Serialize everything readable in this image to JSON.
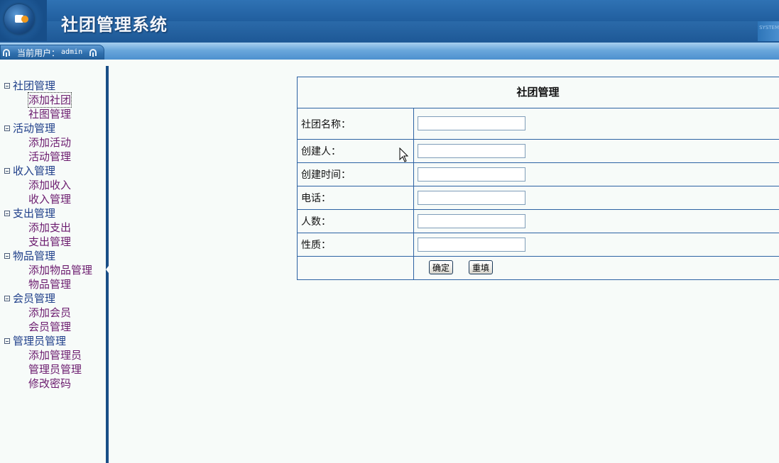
{
  "header": {
    "title": "社团管理系统",
    "system_tag": "SYSTEM"
  },
  "userbar": {
    "label": "当前用户：",
    "username": "admin"
  },
  "sidebar": {
    "groups": [
      {
        "label": "社团管理",
        "items": [
          "添加社团",
          "社图管理"
        ]
      },
      {
        "label": "活动管理",
        "items": [
          "添加活动",
          "活动管理"
        ]
      },
      {
        "label": "收入管理",
        "items": [
          "添加收入",
          "收入管理"
        ]
      },
      {
        "label": "支出管理",
        "items": [
          "添加支出",
          "支出管理"
        ]
      },
      {
        "label": "物品管理",
        "items": [
          "添加物品管理",
          "物品管理"
        ]
      },
      {
        "label": "会员管理",
        "items": [
          "添加会员",
          "会员管理"
        ]
      },
      {
        "label": "管理员管理",
        "items": [
          "添加管理员",
          "管理员管理",
          "修改密码"
        ]
      }
    ]
  },
  "form": {
    "title": "社团管理",
    "fields": [
      {
        "label": "社团名称：",
        "value": ""
      },
      {
        "label": "创建人：",
        "value": ""
      },
      {
        "label": "创建时间：",
        "value": ""
      },
      {
        "label": "电话：",
        "value": ""
      },
      {
        "label": "人数：",
        "value": ""
      },
      {
        "label": "性质：",
        "value": ""
      }
    ],
    "submit_label": "确定",
    "reset_label": "重填"
  },
  "icons": {
    "logo": "logo-icon",
    "user": "user-arch-icon",
    "toggle": "collapse-toggle-icon",
    "cursor": "mouse-cursor-icon"
  },
  "colors": {
    "header": "#1f5c9c",
    "divider": "#1a4f87",
    "table_border": "#2c62a3",
    "group_text": "#1f3f8a",
    "item_text": "#6b1b6e"
  }
}
